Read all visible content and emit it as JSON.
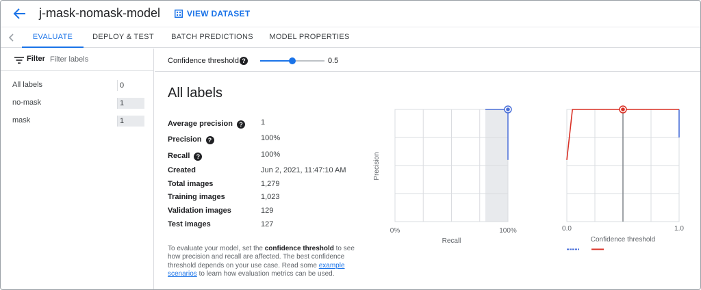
{
  "header": {
    "title": "j-mask-nomask-model",
    "view_dataset": "VIEW DATASET"
  },
  "tabs": [
    {
      "label": "EVALUATE",
      "active": true
    },
    {
      "label": "DEPLOY & TEST",
      "active": false
    },
    {
      "label": "BATCH PREDICTIONS",
      "active": false
    },
    {
      "label": "MODEL PROPERTIES",
      "active": false
    }
  ],
  "sidebar": {
    "filter_label": "Filter",
    "filter_placeholder": "Filter labels",
    "labels": [
      {
        "name": "All labels",
        "count": "0"
      },
      {
        "name": "no-mask",
        "count": "1"
      },
      {
        "name": "mask",
        "count": "1"
      }
    ]
  },
  "threshold": {
    "label": "Confidence threshold",
    "help": "?",
    "value": "0.5",
    "level": 0.5
  },
  "main": {
    "title": "All labels",
    "metrics": [
      {
        "key": "Average precision",
        "value": "1",
        "help": true
      },
      {
        "key": "Precision",
        "value": "100%",
        "help": true
      },
      {
        "key": "Recall",
        "value": "100%",
        "help": true
      },
      {
        "key": "Created",
        "value": "Jun 2, 2021, 11:47:10 AM",
        "help": false
      },
      {
        "key": "Total images",
        "value": "1,279",
        "help": false
      },
      {
        "key": "Training images",
        "value": "1,023",
        "help": false
      },
      {
        "key": "Validation images",
        "value": "129",
        "help": false
      },
      {
        "key": "Test images",
        "value": "127",
        "help": false
      }
    ],
    "description": {
      "part1": "To evaluate your model, set the ",
      "bold": "confidence threshold",
      "part2": " to see how precision and recall are affected. The best confidence threshold depends on your use case. Read some ",
      "link": "example scenarios",
      "part3": " to learn how evaluation metrics can be used."
    }
  },
  "chart_data": [
    {
      "type": "line",
      "title": "",
      "xlabel": "Recall",
      "ylabel": "Precision",
      "x_tick_labels": [
        "0%",
        "100%"
      ],
      "xlim": [
        0,
        1
      ],
      "ylim": [
        0,
        1
      ],
      "grid": true,
      "highlight_region": [
        0.8,
        1.0
      ],
      "series": [
        {
          "x": [
            1.0,
            1.0
          ],
          "y": [
            0.55,
            1.0
          ]
        }
      ],
      "marker": {
        "x": 1.0,
        "y": 1.0
      },
      "colors": {
        "line": "#4a6fd8",
        "marker": "#4a6fd8",
        "region": "#e8eaed"
      }
    },
    {
      "type": "line",
      "title": "",
      "xlabel": "Confidence threshold",
      "x_tick_labels": [
        "0.0",
        "1.0"
      ],
      "xlim": [
        0,
        1
      ],
      "ylim": [
        0,
        1
      ],
      "grid": true,
      "threshold_line": 0.5,
      "series": [
        {
          "x": [
            1.0,
            1.0
          ],
          "y": [
            1.0,
            0.75
          ]
        },
        {
          "x": [
            0.0,
            0.05,
            1.0
          ],
          "y": [
            0.55,
            1.0,
            1.0
          ]
        }
      ],
      "marker": {
        "x": 0.5,
        "y": 1.0
      },
      "legend_placement": "bottom-left",
      "colors": {
        "recall": "#4a6fd8",
        "precision": "#d93025",
        "marker": "#d93025"
      }
    }
  ]
}
